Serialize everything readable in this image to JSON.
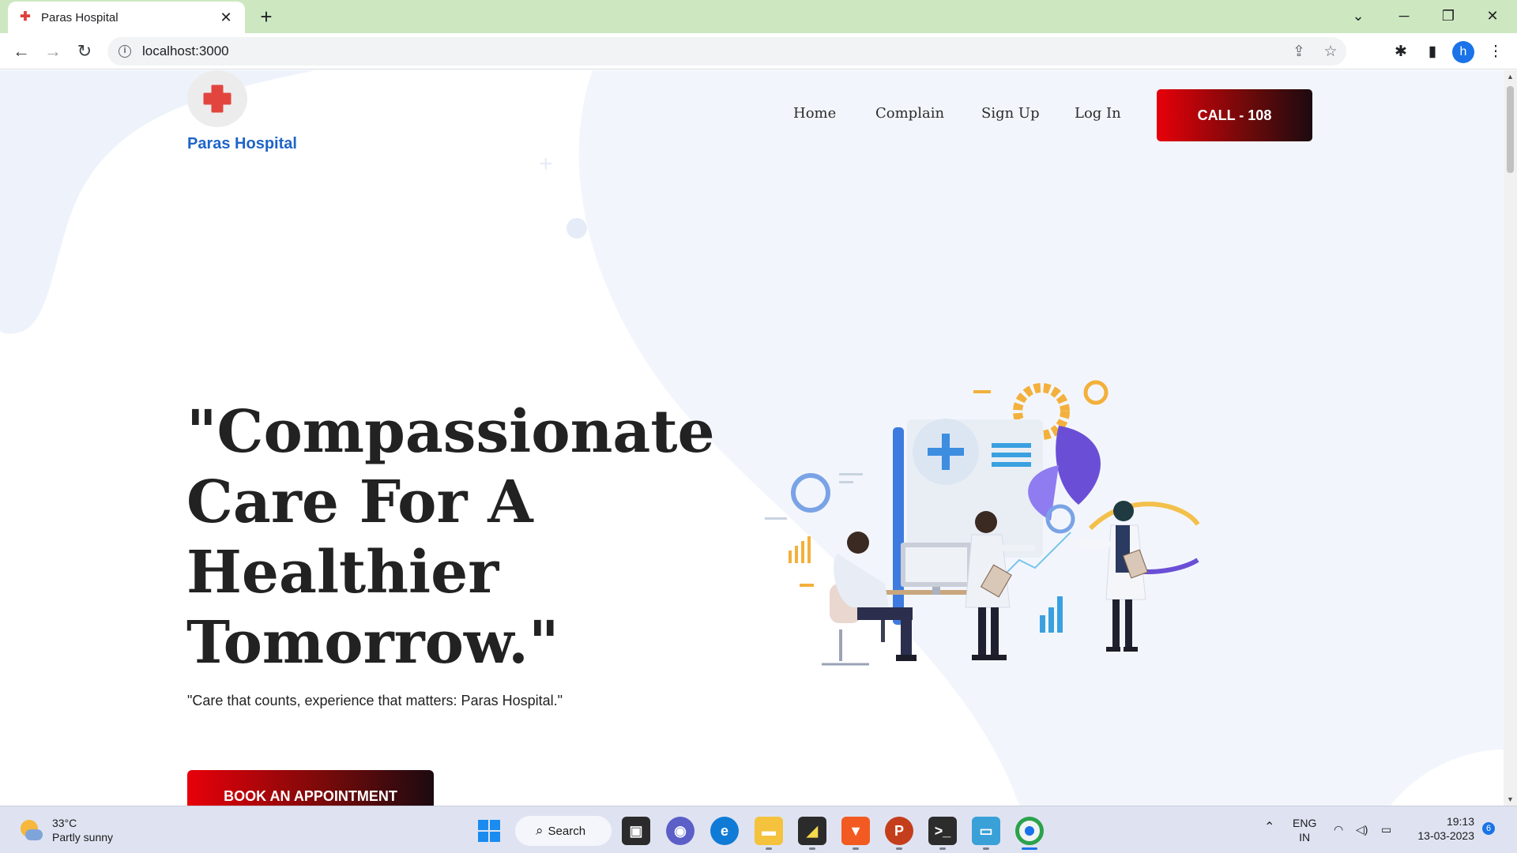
{
  "browser": {
    "tab_title": "Paras Hospital",
    "tab_close": "✕",
    "new_tab": "+",
    "url": "localhost:3000",
    "profile_initial": "h"
  },
  "site": {
    "brand": "Paras Hospital",
    "nav": [
      "Home",
      "Complain",
      "Sign Up",
      "Log In"
    ],
    "call_button": "CALL - 108"
  },
  "hero": {
    "title": "\"Compassionate Care For A Healthier Tomorrow.\"",
    "subtitle": "\"Care that counts, experience that matters: Paras Hospital.\"",
    "cta": "BOOK AN APPOINTMENT"
  },
  "taskbar": {
    "weather_temp": "33°C",
    "weather_desc": "Partly sunny",
    "search_label": "Search",
    "lang_top": "ENG",
    "lang_bottom": "IN",
    "time": "19:13",
    "date": "13-03-2023",
    "notification_count": "6"
  },
  "colors": {
    "brand_blue": "#1f64c8",
    "cta_red": "#e8000a",
    "tab_strip": "#cde8c1",
    "blob": "#f2f6fc"
  },
  "icons": [
    "back-icon",
    "forward-icon",
    "reload-icon",
    "info-icon",
    "share-icon",
    "star-icon",
    "extensions-icon",
    "sidepanel-icon",
    "menu-icon",
    "medical-cross-icon",
    "windows-start-icon",
    "chat-icon",
    "edge-icon",
    "explorer-icon",
    "sticky-notes-icon",
    "brave-icon",
    "powerpoint-icon",
    "terminal-icon",
    "chrome-icon",
    "wifi-icon",
    "volume-icon",
    "battery-icon"
  ]
}
